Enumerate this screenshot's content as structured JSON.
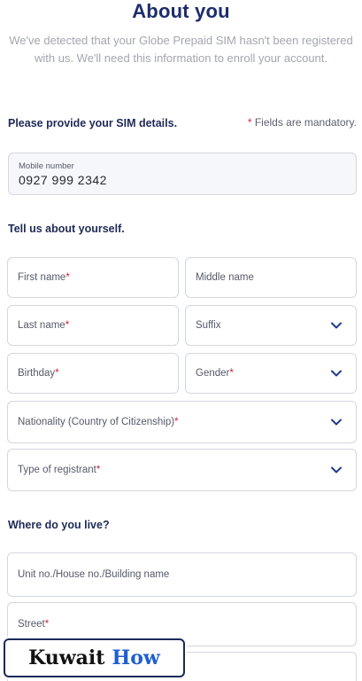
{
  "header": {
    "title": "About you",
    "intro": "We've detected that your Globe Prepaid SIM hasn't been registered with us. We'll need this information to enroll your account."
  },
  "sim_section": {
    "heading": "Please provide your SIM details.",
    "mandatory_star": "*",
    "mandatory_note": "Fields are mandatory.",
    "mobile_label": "Mobile number",
    "mobile_value": "0927 999 2342"
  },
  "about_section": {
    "heading": "Tell us about yourself.",
    "first_name": "First name",
    "middle_name": "Middle name",
    "last_name": "Last name",
    "suffix": "Suffix",
    "birthday": "Birthday",
    "gender": "Gender",
    "nationality": "Nationality (Country of Citizenship)",
    "registrant_type": "Type of registrant",
    "required_mark": "*"
  },
  "address_section": {
    "heading": "Where do you live?",
    "unit": "Unit no./House no./Building name",
    "street": "Street"
  },
  "watermark": {
    "word1": "Kuwait",
    "word2": "How"
  },
  "colors": {
    "title": "#1e2d6b",
    "required": "#d3233a",
    "chevron": "#1f3b8a"
  }
}
